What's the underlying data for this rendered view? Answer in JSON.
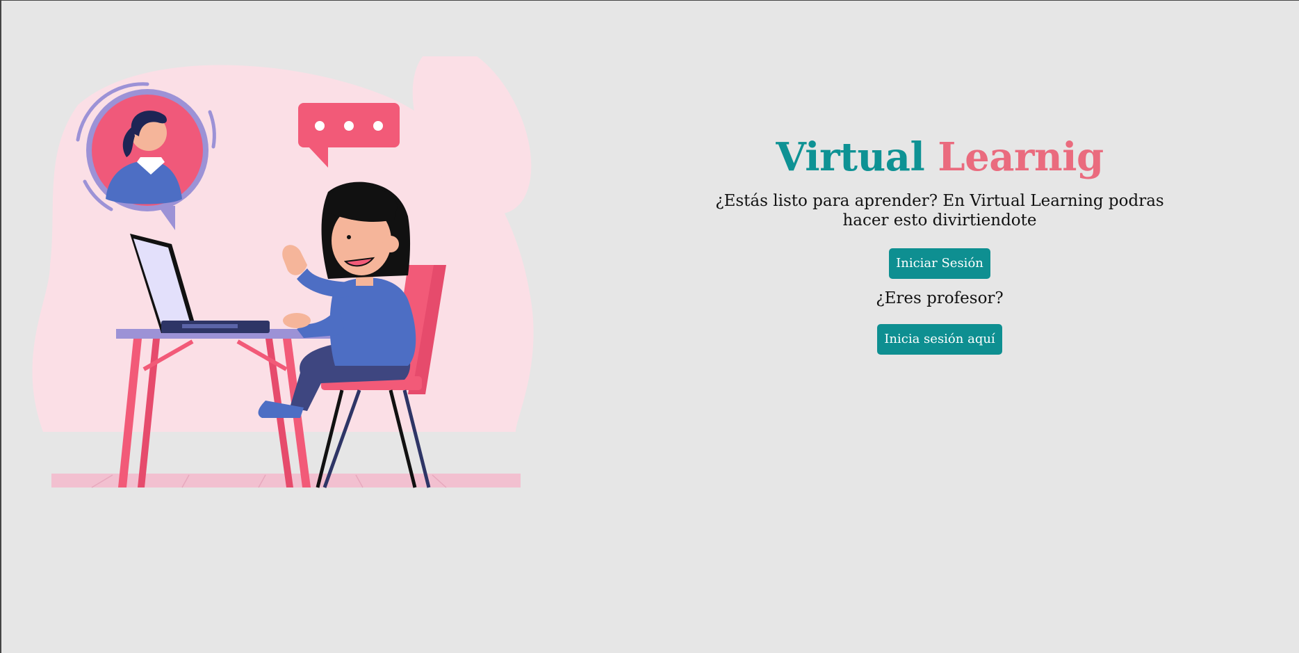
{
  "hero": {
    "title_part1": "Virtual",
    "title_part2": "Learnig",
    "subtitle": "¿Estás listo para aprender? En Virtual Learning podras hacer esto divirtiendote",
    "login_button": "Iniciar Sesión",
    "teacher_question": "¿Eres profesor?",
    "teacher_login_button": "Inicia sesión aquí"
  },
  "colors": {
    "background": "#e6e6e6",
    "primary_teal": "#0e9294",
    "accent_pink": "#ea6b7e",
    "button_bg": "#0e8f91",
    "illustration_blob": "#fbdfe6"
  },
  "illustration": {
    "icons": [
      "teacher-avatar-icon",
      "chat-bubble-icon",
      "laptop-icon",
      "student-figure",
      "chair-icon",
      "desk-icon"
    ]
  }
}
